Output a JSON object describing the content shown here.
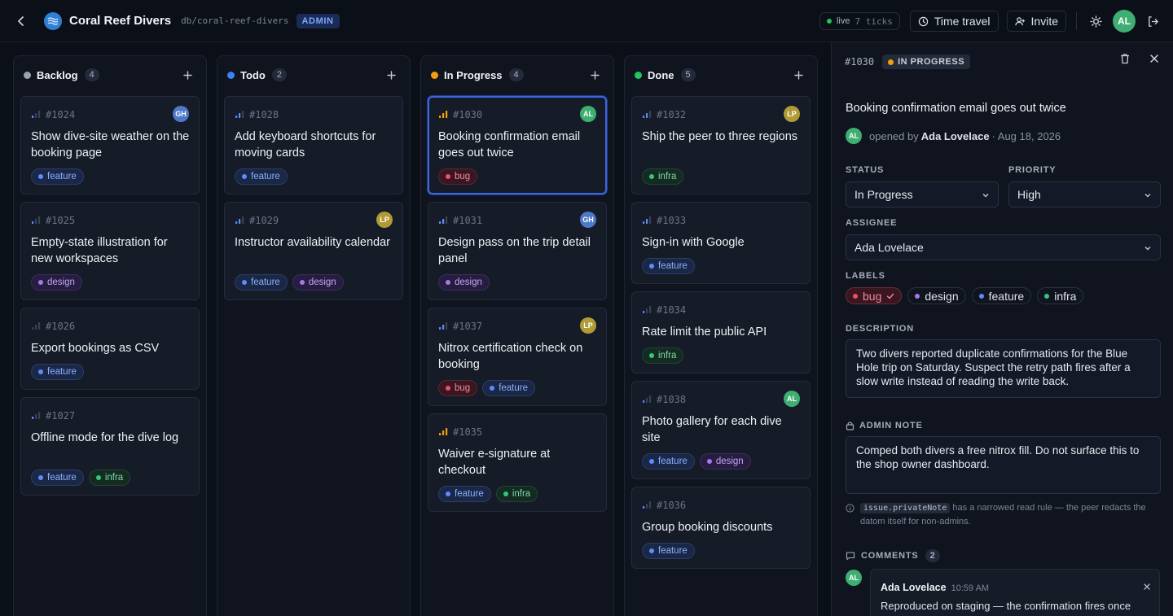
{
  "header": {
    "app_name": "Coral Reef Divers",
    "db_path": "db/coral-reef-divers",
    "role_badge": "ADMIN",
    "live_label": "live",
    "ticks_label": "7 ticks",
    "time_travel_label": "Time travel",
    "invite_label": "Invite",
    "user_initials": "AL"
  },
  "colors": {
    "backlog": "#9ca3af",
    "todo": "#3b82f6",
    "in_progress": "#f59e0b",
    "done": "#22c55e",
    "avatar_AL": "#3fae72",
    "avatar_GH": "#4f78c8",
    "avatar_LP": "#b09b36"
  },
  "columns": [
    {
      "title": "Backlog",
      "count": "4",
      "cards": [
        {
          "id": "#1024",
          "title": "Show dive-site weather on the booking page",
          "priority": "low",
          "assignee": "GH",
          "labels": [
            "feature"
          ]
        },
        {
          "id": "#1025",
          "title": "Empty-state illustration for new workspaces",
          "priority": "low",
          "assignee": "",
          "labels": [
            "design"
          ]
        },
        {
          "id": "#1026",
          "title": "Export bookings as CSV",
          "priority": "none",
          "assignee": "",
          "labels": [
            "feature"
          ]
        },
        {
          "id": "#1027",
          "title": "Offline mode for the dive log",
          "priority": "low",
          "assignee": "",
          "labels": [
            "feature",
            "infra"
          ]
        }
      ]
    },
    {
      "title": "Todo",
      "count": "2",
      "cards": [
        {
          "id": "#1028",
          "title": "Add keyboard shortcuts for moving cards",
          "priority": "medium",
          "assignee": "",
          "labels": [
            "feature"
          ]
        },
        {
          "id": "#1029",
          "title": "Instructor availability calendar",
          "priority": "medium",
          "assignee": "LP",
          "labels": [
            "feature",
            "design"
          ]
        }
      ]
    },
    {
      "title": "In Progress",
      "count": "4",
      "cards": [
        {
          "id": "#1030",
          "title": "Booking confirmation email goes out twice",
          "priority": "high",
          "assignee": "AL",
          "labels": [
            "bug"
          ],
          "selected": true
        },
        {
          "id": "#1031",
          "title": "Design pass on the trip detail panel",
          "priority": "medium",
          "assignee": "GH",
          "labels": [
            "design"
          ]
        },
        {
          "id": "#1037",
          "title": "Nitrox certification check on booking",
          "priority": "medium",
          "assignee": "LP",
          "labels": [
            "bug",
            "feature"
          ]
        },
        {
          "id": "#1035",
          "title": "Waiver e-signature at checkout",
          "priority": "high",
          "assignee": "",
          "labels": [
            "feature",
            "infra"
          ]
        }
      ]
    },
    {
      "title": "Done",
      "count": "5",
      "cards": [
        {
          "id": "#1032",
          "title": "Ship the peer to three regions",
          "priority": "medium",
          "assignee": "LP",
          "labels": [
            "infra"
          ]
        },
        {
          "id": "#1033",
          "title": "Sign-in with Google",
          "priority": "medium",
          "assignee": "",
          "labels": [
            "feature"
          ]
        },
        {
          "id": "#1034",
          "title": "Rate limit the public API",
          "priority": "low",
          "assignee": "",
          "labels": [
            "infra"
          ]
        },
        {
          "id": "#1038",
          "title": "Photo gallery for each dive site",
          "priority": "low",
          "assignee": "AL",
          "labels": [
            "feature",
            "design"
          ]
        },
        {
          "id": "#1036",
          "title": "Group booking discounts",
          "priority": "low",
          "assignee": "",
          "labels": [
            "feature"
          ]
        }
      ]
    }
  ],
  "detail": {
    "id": "#1030",
    "status_badge": "IN PROGRESS",
    "title": "Booking confirmation email goes out twice",
    "opened_prefix": "opened by",
    "opened_by": "Ada Lovelace",
    "opened_date": "· Aug 18, 2026",
    "opener_initials": "AL",
    "status_label": "STATUS",
    "status_value": "In Progress",
    "priority_label": "PRIORITY",
    "priority_value": "High",
    "assignee_label": "ASSIGNEE",
    "assignee_value": "Ada Lovelace",
    "labels_label": "LABELS",
    "labels": [
      {
        "name": "bug",
        "active": true
      },
      {
        "name": "design",
        "active": false
      },
      {
        "name": "feature",
        "active": false
      },
      {
        "name": "infra",
        "active": false
      }
    ],
    "description_label": "DESCRIPTION",
    "description": "Two divers reported duplicate confirmations for the Blue Hole trip on Saturday. Suspect the retry path fires after a slow write instead of reading the write back.",
    "admin_note_label": "ADMIN NOTE",
    "admin_note": "Comped both divers a free nitrox fill. Do not surface this to the shop owner dashboard.",
    "hint_code": "issue.privateNote",
    "hint_text": " has a narrowed read rule — the peer redacts the datom itself for non-admins.",
    "comments_label": "COMMENTS",
    "comments_count": "2",
    "comment": {
      "initials": "AL",
      "author": "Ada Lovelace",
      "time": "10:59 AM",
      "body": "Reproduced on staging — the confirmation fires once"
    }
  }
}
